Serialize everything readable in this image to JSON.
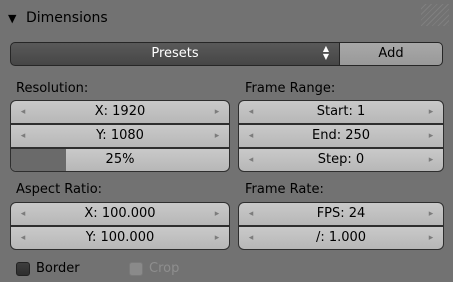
{
  "panel": {
    "title": "Dimensions",
    "collapse_glyph": "▼"
  },
  "presets": {
    "label": "Presets",
    "updown_glyph": "▲▼",
    "add_label": "Add"
  },
  "resolution": {
    "label": "Resolution:",
    "x": "X: 1920",
    "y": "Y: 1080",
    "percent": "25%",
    "percent_value": 0.25
  },
  "frame_range": {
    "label": "Frame Range:",
    "start": "Start: 1",
    "end": "End: 250",
    "step": "Step: 0"
  },
  "aspect_ratio": {
    "label": "Aspect Ratio:",
    "x": "X: 100.000",
    "y": "Y: 100.000"
  },
  "frame_rate": {
    "label": "Frame Rate:",
    "fps": "FPS: 24",
    "base": "/: 1.000"
  },
  "checkboxes": {
    "border": "Border",
    "crop": "Crop"
  },
  "arrows": {
    "left": "◂",
    "right": "▸"
  }
}
